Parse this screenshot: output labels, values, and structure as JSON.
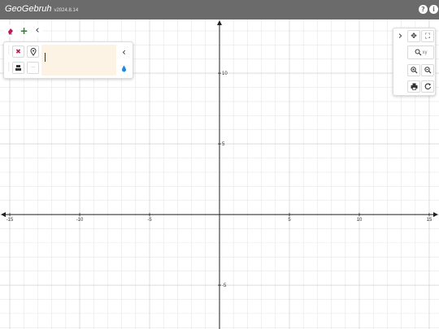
{
  "app": {
    "title": "GeoGebruh",
    "version": "v2024.8.14"
  },
  "titlebar": {
    "help_icon": "question-circle-icon",
    "info_icon": "info-circle-icon",
    "help_glyph": "?",
    "info_glyph": "i"
  },
  "toolbar": {
    "undo_icon": "eraser-icon",
    "add_icon": "plus-icon",
    "add_glyph": "+",
    "collapse_icon": "chevron-left-icon",
    "collapse_glyph": "‹"
  },
  "algebra": {
    "input_value": "",
    "delete_icon": "delete-x-icon",
    "delete_glyph": "✖",
    "point_icon": "point-marker-icon",
    "style_icon": "style-brush-icon",
    "more_glyph": "···",
    "collapse_glyph": "‹",
    "drop_icon": "color-drop-icon"
  },
  "graphics": {
    "expand_glyph": "›",
    "move_icon": "move-arrows-icon",
    "move_glyph": "✥",
    "fullscreen_icon": "fullscreen-icon",
    "fullscreen_glyph": "⛶",
    "zoom_xy_label": "xy",
    "zoom_in_icon": "zoom-in-icon",
    "zoom_out_icon": "zoom-out-icon",
    "print_icon": "print-icon",
    "export_icon": "export-icon"
  },
  "axes": {
    "x_ticks": [
      -15,
      -10,
      -5,
      5,
      10,
      15
    ],
    "y_ticks": [
      10,
      5,
      -5
    ],
    "x_range": [
      -15.7,
      15.7
    ],
    "y_range": [
      -8.1,
      13.8
    ],
    "grid": true,
    "grid_color": "#e6e6e6",
    "major_grid_color": "#c8c8c8",
    "axis_color": "#222222"
  }
}
